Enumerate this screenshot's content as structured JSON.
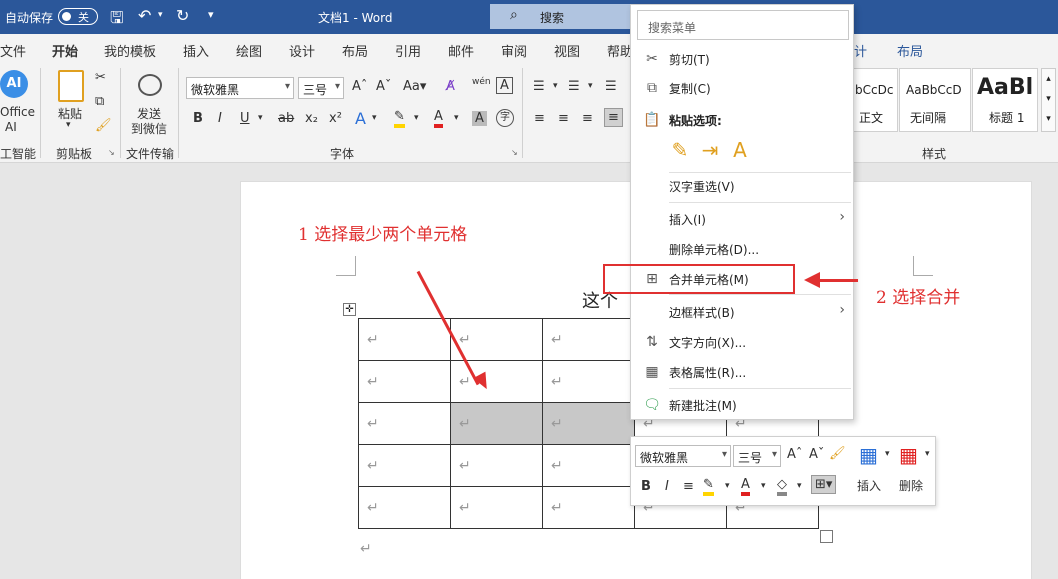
{
  "titlebar": {
    "autosave_label": "自动保存",
    "autosave_state": "关",
    "doc_title": "文档1 - Word",
    "search_label": "搜索"
  },
  "tabs": [
    "文件",
    "开始",
    "我的模板",
    "插入",
    "绘图",
    "设计",
    "布局",
    "引用",
    "邮件",
    "审阅",
    "视图",
    "帮助"
  ],
  "tabs_right": [
    "计",
    "布局"
  ],
  "ribbon": {
    "groups": {
      "ai": "工智能",
      "clipboard": "剪贴板",
      "transfer": "文件传输",
      "font": "字体",
      "styles": "样式"
    },
    "office_ai": [
      "Office",
      "AI"
    ],
    "paste": "粘贴",
    "send_to_wechat": [
      "发送",
      "到微信"
    ],
    "font_name": "微软雅黑",
    "font_size": "三号",
    "styles": [
      {
        "sample": "bCcDc",
        "name": "正文"
      },
      {
        "sample": "AaBbCcD",
        "name": "无间隔"
      },
      {
        "sample": "AaBl",
        "name": "标题 1"
      }
    ]
  },
  "document": {
    "title_fragment": "这个",
    "paragraph_mark": "↵"
  },
  "annotations": {
    "step1": "1 选择最少两个单元格",
    "step2": "2 选择合并"
  },
  "context_menu": {
    "search_placeholder": "搜索菜单",
    "items": {
      "cut": "剪切(T)",
      "copy": "复制(C)",
      "paste_options": "粘贴选项:",
      "reconvert": "汉字重选(V)",
      "insert": "插入(I)",
      "delete_cells": "删除单元格(D)...",
      "merge_cells": "合并单元格(M)",
      "border_styles": "边框样式(B)",
      "text_direction": "文字方向(X)...",
      "table_properties": "表格属性(R)...",
      "new_comment": "新建批注(M)"
    }
  },
  "mini_toolbar": {
    "font_name": "微软雅黑",
    "font_size": "三号",
    "insert": "插入",
    "delete": "删除"
  },
  "colors": {
    "title_blue": "#2b579a",
    "annotation_red": "#e03030",
    "selection_gray": "#c8c8c8"
  }
}
